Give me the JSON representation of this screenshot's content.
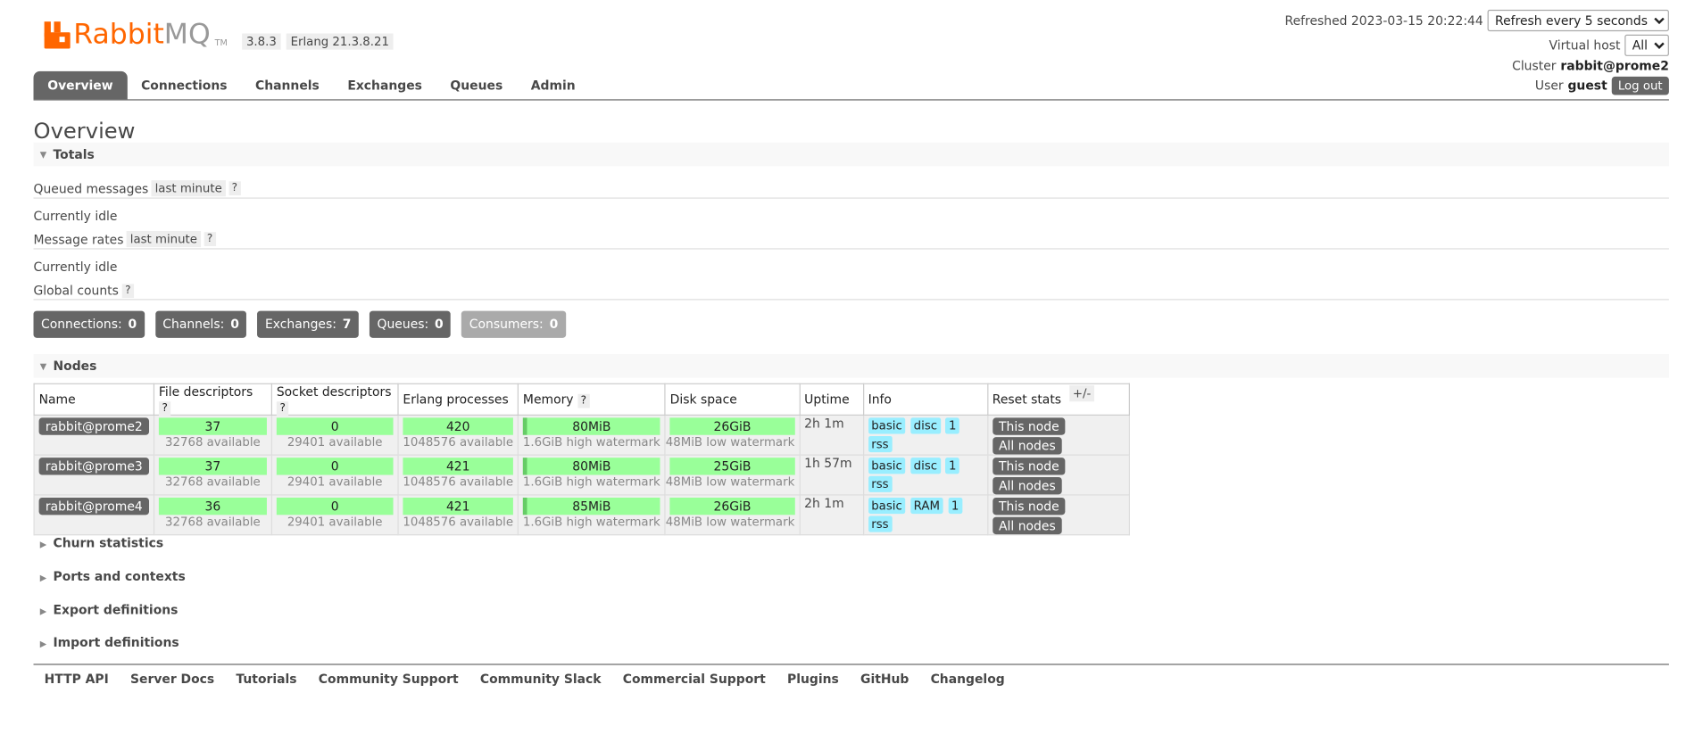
{
  "header": {
    "logo_rabbit": "Rabbit",
    "logo_mq": "MQ",
    "logo_tm": "TM",
    "version": "3.8.3",
    "erlang": "Erlang 21.3.8.21",
    "refreshed_label": "Refreshed 2023-03-15 20:22:44",
    "refresh_select": "Refresh every 5 seconds",
    "vhost_label": "Virtual host",
    "vhost_select": "All",
    "cluster_label": "Cluster",
    "cluster_value": "rabbit@prome2",
    "user_label": "User",
    "user_value": "guest",
    "logout_label": "Log out"
  },
  "tabs": [
    "Overview",
    "Connections",
    "Channels",
    "Exchanges",
    "Queues",
    "Admin"
  ],
  "page_title": "Overview",
  "totals": {
    "title": "Totals",
    "queued_label": "Queued messages",
    "queued_range": "last minute",
    "help": "?",
    "idle1": "Currently idle",
    "rates_label": "Message rates",
    "rates_range": "last minute",
    "idle2": "Currently idle",
    "global_label": "Global counts"
  },
  "counts": [
    {
      "label": "Connections:",
      "value": "0"
    },
    {
      "label": "Channels:",
      "value": "0"
    },
    {
      "label": "Exchanges:",
      "value": "7"
    },
    {
      "label": "Queues:",
      "value": "0"
    },
    {
      "label": "Consumers:",
      "value": "0"
    }
  ],
  "nodes": {
    "title": "Nodes",
    "headers": [
      "Name",
      "File descriptors",
      "Socket descriptors",
      "Erlang processes",
      "Memory",
      "Disk space",
      "Uptime",
      "Info",
      "Reset stats"
    ],
    "plusminus": "+/-",
    "this_node": "This node",
    "all_nodes": "All nodes",
    "rows": [
      {
        "name": "rabbit@prome2",
        "fd": "37",
        "fd_avail": "32768 available",
        "sd": "0",
        "sd_avail": "29401 available",
        "ep": "420",
        "ep_avail": "1048576 available",
        "mem": "80MiB",
        "mem_sub": "1.6GiB high watermark",
        "disk": "26GiB",
        "disk_sub": "48MiB low watermark",
        "uptime": "2h 1m",
        "info": [
          "basic",
          "disc",
          "1",
          "rss"
        ]
      },
      {
        "name": "rabbit@prome3",
        "fd": "37",
        "fd_avail": "32768 available",
        "sd": "0",
        "sd_avail": "29401 available",
        "ep": "421",
        "ep_avail": "1048576 available",
        "mem": "80MiB",
        "mem_sub": "1.6GiB high watermark",
        "disk": "25GiB",
        "disk_sub": "48MiB low watermark",
        "uptime": "1h 57m",
        "info": [
          "basic",
          "disc",
          "1",
          "rss"
        ]
      },
      {
        "name": "rabbit@prome4",
        "fd": "36",
        "fd_avail": "32768 available",
        "sd": "0",
        "sd_avail": "29401 available",
        "ep": "421",
        "ep_avail": "1048576 available",
        "mem": "85MiB",
        "mem_sub": "1.6GiB high watermark",
        "disk": "26GiB",
        "disk_sub": "48MiB low watermark",
        "uptime": "2h 1m",
        "info": [
          "basic",
          "RAM",
          "1",
          "rss"
        ]
      }
    ]
  },
  "sections": [
    "Churn statistics",
    "Ports and contexts",
    "Export definitions",
    "Import definitions"
  ],
  "footer": [
    "HTTP API",
    "Server Docs",
    "Tutorials",
    "Community Support",
    "Community Slack",
    "Commercial Support",
    "Plugins",
    "GitHub",
    "Changelog"
  ],
  "colors": {
    "brand": "#ff6600",
    "tab_active": "#666666",
    "bar_green": "#99ff99",
    "info_tag": "#99eeff"
  }
}
